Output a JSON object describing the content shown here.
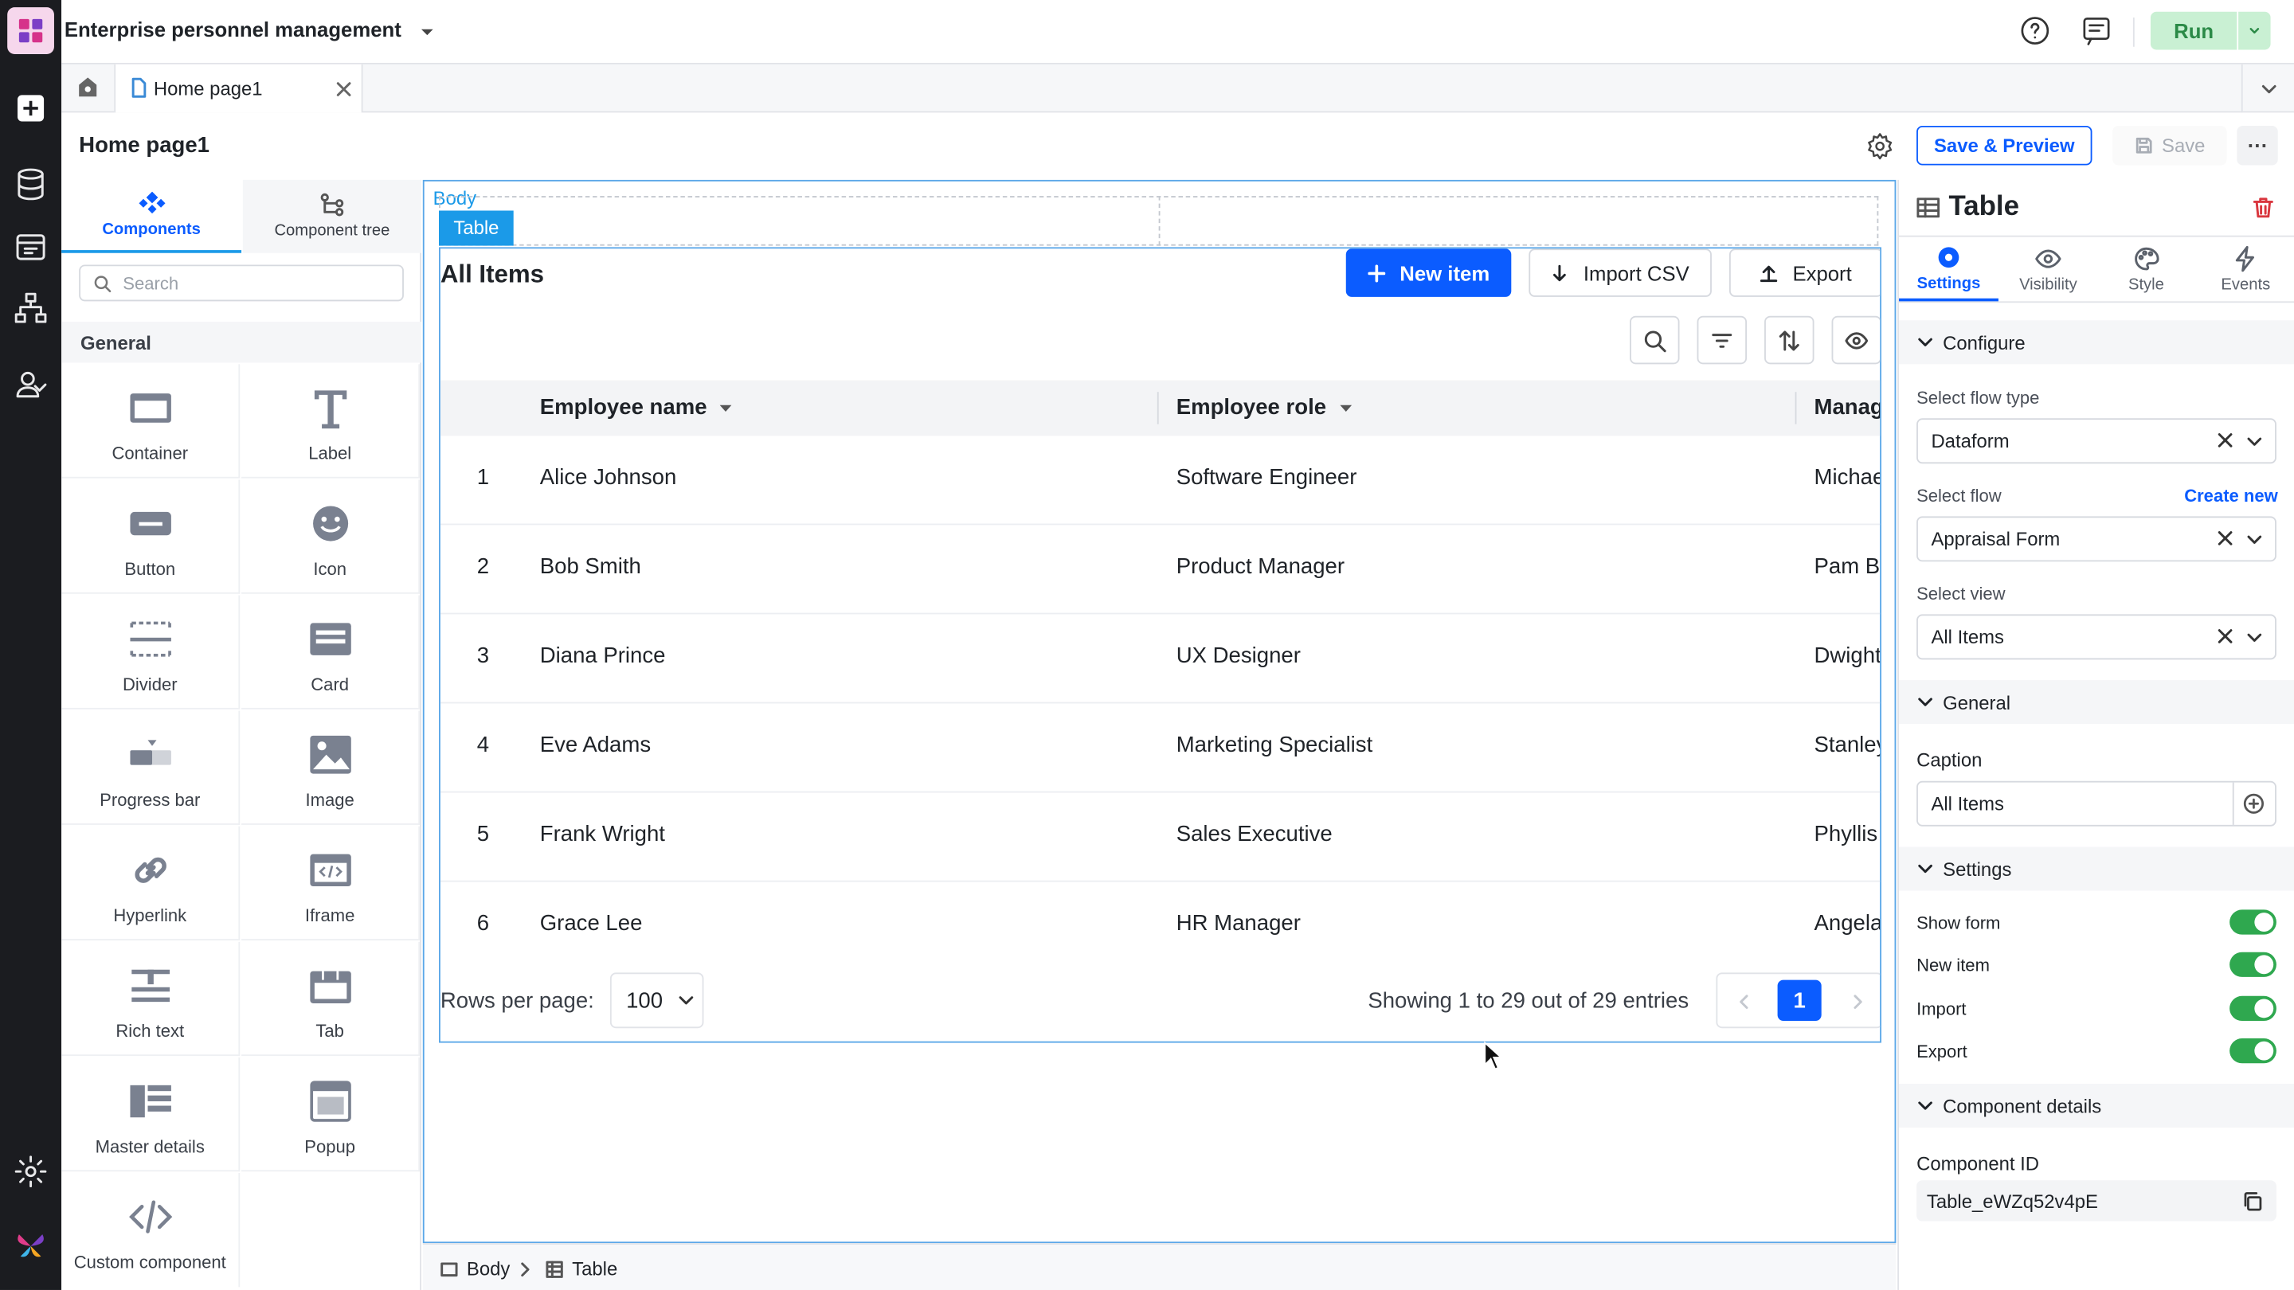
{
  "app": {
    "title": "Enterprise personnel management",
    "run_label": "Run"
  },
  "tabs": [
    {
      "label": "Home page1"
    }
  ],
  "page": {
    "title": "Home page1",
    "save_preview_label": "Save & Preview",
    "save_label": "Save"
  },
  "left_panel": {
    "tabs": [
      {
        "label": "Components"
      },
      {
        "label": "Component tree"
      }
    ],
    "search_placeholder": "Search",
    "section": "General",
    "components": [
      {
        "label": "Container",
        "icon": "container-icon"
      },
      {
        "label": "Label",
        "icon": "label-icon"
      },
      {
        "label": "Button",
        "icon": "button-icon"
      },
      {
        "label": "Icon",
        "icon": "smiley-icon"
      },
      {
        "label": "Divider",
        "icon": "divider-icon"
      },
      {
        "label": "Card",
        "icon": "card-icon"
      },
      {
        "label": "Progress bar",
        "icon": "progress-bar-icon"
      },
      {
        "label": "Image",
        "icon": "image-icon"
      },
      {
        "label": "Hyperlink",
        "icon": "link-icon"
      },
      {
        "label": "Iframe",
        "icon": "iframe-icon"
      },
      {
        "label": "Rich text",
        "icon": "rich-text-icon"
      },
      {
        "label": "Tab",
        "icon": "tab-icon"
      },
      {
        "label": "Master details",
        "icon": "master-details-icon"
      },
      {
        "label": "Popup",
        "icon": "popup-icon"
      },
      {
        "label": "Custom component",
        "icon": "code-icon"
      }
    ]
  },
  "canvas": {
    "body_tag": "Body",
    "table_tag": "Table",
    "table": {
      "title": "All Items",
      "new_item_label": "New item",
      "import_label": "Import CSV",
      "export_label": "Export",
      "columns": [
        "Employee name",
        "Employee role",
        "Manag"
      ],
      "rows": [
        {
          "n": "1",
          "name": "Alice Johnson",
          "role": "Software Engineer",
          "manager": "Michae"
        },
        {
          "n": "2",
          "name": "Bob Smith",
          "role": "Product Manager",
          "manager": "Pam B"
        },
        {
          "n": "3",
          "name": "Diana Prince",
          "role": "UX Designer",
          "manager": "Dwight"
        },
        {
          "n": "4",
          "name": "Eve Adams",
          "role": "Marketing Specialist",
          "manager": "Stanley"
        },
        {
          "n": "5",
          "name": "Frank Wright",
          "role": "Sales Executive",
          "manager": "Phyllis"
        },
        {
          "n": "6",
          "name": "Grace Lee",
          "role": "HR Manager",
          "manager": "Angela"
        }
      ],
      "rows_per_page_label": "Rows per page:",
      "rows_per_page": "100",
      "showing": "Showing 1 to 29 out of 29 entries",
      "current_page": "1"
    }
  },
  "breadcrumb": [
    "Body",
    "Table"
  ],
  "right_panel": {
    "title": "Table",
    "tabs": [
      {
        "label": "Settings"
      },
      {
        "label": "Visibility"
      },
      {
        "label": "Style"
      },
      {
        "label": "Events"
      }
    ],
    "configure": {
      "header": "Configure",
      "flow_type_label": "Select flow type",
      "flow_type": "Dataform",
      "flow_label": "Select flow",
      "create_new": "Create new",
      "flow": "Appraisal Form",
      "view_label": "Select view",
      "view": "All Items"
    },
    "general": {
      "header": "General",
      "caption_label": "Caption",
      "caption": "All Items"
    },
    "settings": {
      "header": "Settings",
      "toggles": [
        {
          "label": "Show form",
          "on": true
        },
        {
          "label": "New item",
          "on": true
        },
        {
          "label": "Import",
          "on": true
        },
        {
          "label": "Export",
          "on": true
        }
      ]
    },
    "details": {
      "header": "Component details",
      "id_label": "Component ID",
      "id": "Table_eWZq52v4pE"
    }
  },
  "colors": {
    "primary": "#0b5cff",
    "run": "#c9f0d3",
    "accent_blue": "#1b9ae8",
    "toggle_on": "#2fa84f"
  }
}
